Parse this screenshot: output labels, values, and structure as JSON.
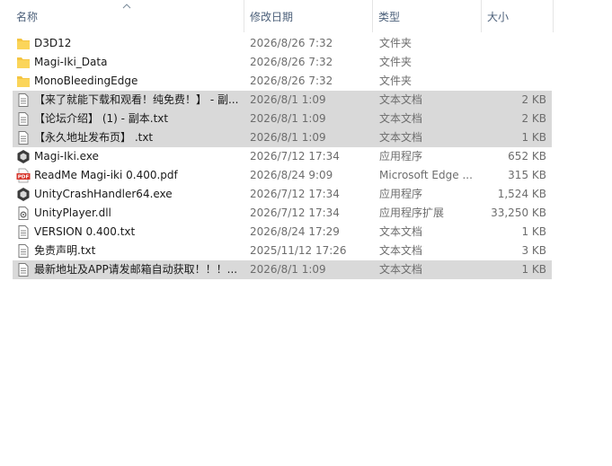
{
  "columns": {
    "name": "名称",
    "date": "修改日期",
    "type": "类型",
    "size": "大小"
  },
  "files": [
    {
      "name": "D3D12",
      "date": "2026/8/26 7:32",
      "type": "文件夹",
      "size": "",
      "icon": "folder-icon",
      "selected": false
    },
    {
      "name": "Magi-Iki_Data",
      "date": "2026/8/26 7:32",
      "type": "文件夹",
      "size": "",
      "icon": "folder-icon",
      "selected": false
    },
    {
      "name": "MonoBleedingEdge",
      "date": "2026/8/26 7:32",
      "type": "文件夹",
      "size": "",
      "icon": "folder-icon",
      "selected": false
    },
    {
      "name": "【来了就能下载和观看！纯免费！】 - 副...",
      "date": "2026/8/1 1:09",
      "type": "文本文档",
      "size": "2 KB",
      "icon": "text-file-icon",
      "selected": true
    },
    {
      "name": "【论坛介绍】 (1) - 副本.txt",
      "date": "2026/8/1 1:09",
      "type": "文本文档",
      "size": "2 KB",
      "icon": "text-file-icon",
      "selected": true
    },
    {
      "name": "【永久地址发布页】 .txt",
      "date": "2026/8/1 1:09",
      "type": "文本文档",
      "size": "1 KB",
      "icon": "text-file-icon",
      "selected": true
    },
    {
      "name": "Magi-Iki.exe",
      "date": "2026/7/12 17:34",
      "type": "应用程序",
      "size": "652 KB",
      "icon": "unity-exe-icon",
      "selected": false
    },
    {
      "name": "ReadMe Magi-iki 0.400.pdf",
      "date": "2026/8/24 9:09",
      "type": "Microsoft Edge ...",
      "size": "315 KB",
      "icon": "pdf-icon",
      "selected": false
    },
    {
      "name": "UnityCrashHandler64.exe",
      "date": "2026/7/12 17:34",
      "type": "应用程序",
      "size": "1,524 KB",
      "icon": "unity-exe-icon",
      "selected": false
    },
    {
      "name": "UnityPlayer.dll",
      "date": "2026/7/12 17:34",
      "type": "应用程序扩展",
      "size": "33,250 KB",
      "icon": "dll-icon",
      "selected": false
    },
    {
      "name": "VERSION 0.400.txt",
      "date": "2026/8/24 17:29",
      "type": "文本文档",
      "size": "1 KB",
      "icon": "text-file-icon",
      "selected": false
    },
    {
      "name": "免责声明.txt",
      "date": "2025/11/12 17:26",
      "type": "文本文档",
      "size": "3 KB",
      "icon": "text-file-icon",
      "selected": false
    },
    {
      "name": "最新地址及APP请发邮箱自动获取！！！...",
      "date": "2026/8/1 1:09",
      "type": "文本文档",
      "size": "1 KB",
      "icon": "text-file-icon",
      "selected": true
    }
  ],
  "colors": {
    "selection": "#d9d9d9",
    "folder": "#f5c542",
    "pdf": "#d7342a",
    "header_text": "#4c607a"
  }
}
